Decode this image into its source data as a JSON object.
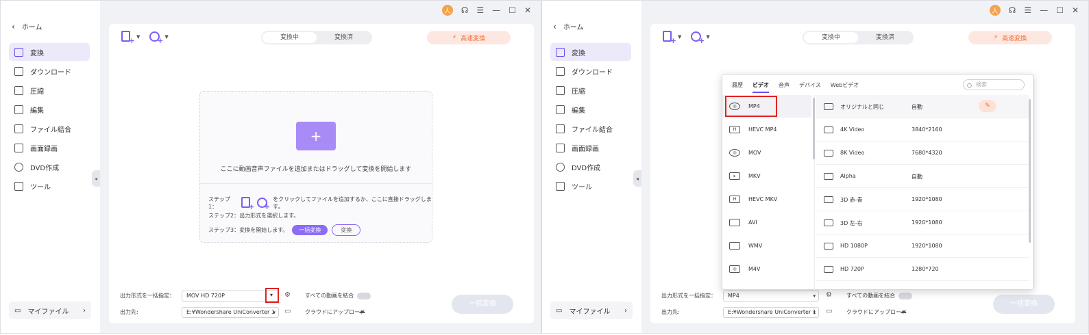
{
  "common": {
    "home": "ホーム",
    "nav": [
      "変換",
      "ダウンロード",
      "圧縮",
      "編集",
      "ファイル結合",
      "画面録画",
      "DVD作成",
      "ツール"
    ],
    "myfiles": "マイファイル",
    "avatar": "人",
    "seg": [
      "変換中",
      "変換済"
    ],
    "fast": "高速変換",
    "out_label": "出力形式を一括指定：",
    "dest_label": "出力先:",
    "dest_value": "E:¥Wondershare UniConverter 1",
    "merge": "すべての動画を結合",
    "cloud": "クラウドにアップロード",
    "convert_all": "一括変換"
  },
  "left": {
    "drop_text": "ここに動画音声ファイルを追加またはドラッグして変換を開始します",
    "step1a": "ステップ1：",
    "step1b": "をクリックしてファイルを追加するか、ここに直接ドラッグします。",
    "step2": "ステップ2：出力形式を選択します。",
    "step3": "ステップ3：変換を開始します。",
    "btn_all": "一括変換",
    "btn_conv": "変換",
    "format_value": "MOV HD 720P"
  },
  "right": {
    "format_value": "MP4",
    "tabs": [
      "履歴",
      "ビデオ",
      "音声",
      "デバイス",
      "Webビデオ"
    ],
    "search": "検索",
    "formats": [
      "MP4",
      "HEVC MP4",
      "MOV",
      "MKV",
      "HEVC MKV",
      "AVI",
      "WMV",
      "M4V"
    ],
    "qualities": [
      {
        "name": "オリジナルと同じ",
        "res": "自動"
      },
      {
        "name": "4K Video",
        "res": "3840*2160"
      },
      {
        "name": "8K Video",
        "res": "7680*4320"
      },
      {
        "name": "Alpha",
        "res": "自動"
      },
      {
        "name": "3D 赤-青",
        "res": "1920*1080"
      },
      {
        "name": "3D 左-右",
        "res": "1920*1080"
      },
      {
        "name": "HD 1080P",
        "res": "1920*1080"
      },
      {
        "name": "HD 720P",
        "res": "1280*720"
      }
    ]
  },
  "colors": {
    "accent": "#7b5cf5",
    "fast": "#f06a2e",
    "highlight": "#e02323"
  }
}
